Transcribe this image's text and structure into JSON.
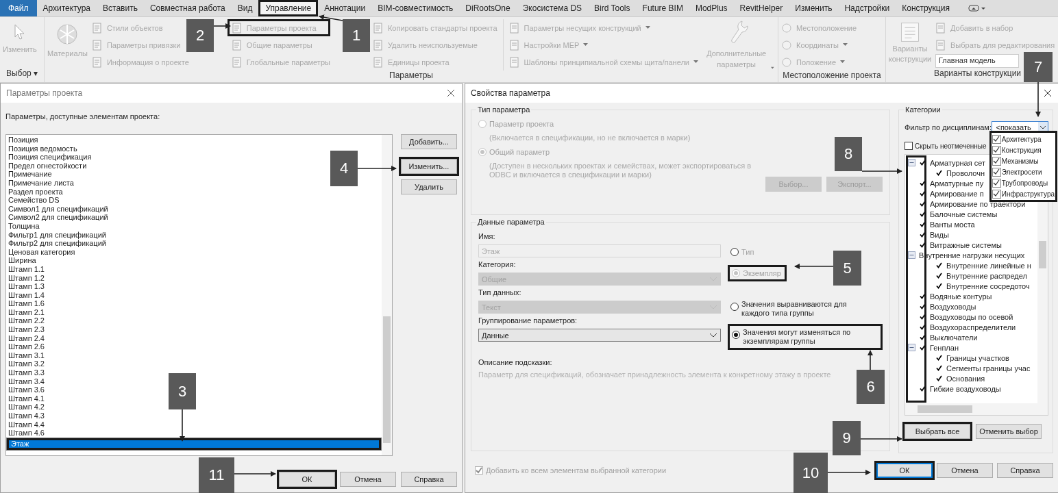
{
  "ribbon_tabs": [
    {
      "label": "Файл",
      "kind": "file",
      "selected": false
    },
    {
      "label": "Архитектура",
      "kind": "tab",
      "selected": false
    },
    {
      "label": "Вставить",
      "kind": "tab",
      "selected": false
    },
    {
      "label": "Совместная работа",
      "kind": "tab",
      "selected": false
    },
    {
      "label": "Вид",
      "kind": "tab",
      "selected": false
    },
    {
      "label": "Управление",
      "kind": "tab",
      "selected": true
    },
    {
      "label": "Аннотации",
      "kind": "tab",
      "selected": false
    },
    {
      "label": "BIM-совместимость",
      "kind": "tab",
      "selected": false
    },
    {
      "label": "DiRootsOne",
      "kind": "tab",
      "selected": false
    },
    {
      "label": "Экосистема DS",
      "kind": "tab",
      "selected": false
    },
    {
      "label": "Bird Tools",
      "kind": "tab",
      "selected": false
    },
    {
      "label": "Future BIM",
      "kind": "tab",
      "selected": false
    },
    {
      "label": "ModPlus",
      "kind": "tab",
      "selected": false
    },
    {
      "label": "RevitHelper",
      "kind": "tab",
      "selected": false
    },
    {
      "label": "Изменить",
      "kind": "tab",
      "selected": false
    },
    {
      "label": "Надстройки",
      "kind": "tab",
      "selected": false
    },
    {
      "label": "Конструкция",
      "kind": "tab",
      "selected": false
    }
  ],
  "ribbon": {
    "select_group": {
      "button": "Изменить",
      "label": "Выбор",
      "caret": "▾"
    },
    "params_group": {
      "label": "Параметры",
      "big_button": "Материалы",
      "columns": [
        [
          "Стили объектов",
          "Параметры привязки",
          "Информация о проекте"
        ],
        [
          "Параметры проекта",
          "Общие параметры",
          "Глобальные  параметры"
        ],
        [
          "Копировать стандарты проекта",
          "Удалить неиспользуемые",
          "Единицы проекта"
        ]
      ],
      "dropdowns": [
        "Параметры несущих конструкций",
        "Настройки MEP",
        "Шаблоны принципиальной схемы щита/панели"
      ],
      "extra_button": "Дополнительные параметры"
    },
    "location_group": {
      "label": "Местоположение проекта",
      "items": [
        {
          "label": "Местоположение",
          "dropdown": false
        },
        {
          "label": "Координаты",
          "dropdown": true
        },
        {
          "label": "Положение",
          "dropdown": true
        }
      ]
    },
    "options_group": {
      "label": "Варианты конструкции",
      "big_button": "Варианты конструкции",
      "items": [
        "Добавить в набор",
        "Выбрать для редактирования"
      ],
      "combo": "Главная модель"
    }
  },
  "project_dialog": {
    "title": "Параметры проекта",
    "caption": "Параметры, доступные элементам проекта:",
    "items": [
      {
        "label": "Позиция",
        "selected": false
      },
      {
        "label": "Позиция ведомость",
        "selected": false
      },
      {
        "label": "Позиция спецификация",
        "selected": false
      },
      {
        "label": "Предел огнестойкости",
        "selected": false
      },
      {
        "label": "Примечание",
        "selected": false
      },
      {
        "label": "Примечание листа",
        "selected": false
      },
      {
        "label": "Раздел проекта",
        "selected": false
      },
      {
        "label": "Семейство DS",
        "selected": false
      },
      {
        "label": "Символ1 для спецификаций",
        "selected": false
      },
      {
        "label": "Символ2 для спецификаций",
        "selected": false
      },
      {
        "label": "Толщина",
        "selected": false
      },
      {
        "label": "Фильтр1 для спецификаций",
        "selected": false
      },
      {
        "label": "Фильтр2 для спецификаций",
        "selected": false
      },
      {
        "label": "Ценовая категория",
        "selected": false
      },
      {
        "label": "Ширина",
        "selected": false
      },
      {
        "label": "Штамп 1.1",
        "selected": false
      },
      {
        "label": "Штамп 1.2",
        "selected": false
      },
      {
        "label": "Штамп 1.3",
        "selected": false
      },
      {
        "label": "Штамп 1.4",
        "selected": false
      },
      {
        "label": "Штамп 1.6",
        "selected": false
      },
      {
        "label": "Штамп 2.1",
        "selected": false
      },
      {
        "label": "Штамп 2.2",
        "selected": false
      },
      {
        "label": "Штамп 2.3",
        "selected": false
      },
      {
        "label": "Штамп 2.4",
        "selected": false
      },
      {
        "label": "Штамп 2.6",
        "selected": false
      },
      {
        "label": "Штамп 3.1",
        "selected": false
      },
      {
        "label": "Штамп 3.2",
        "selected": false
      },
      {
        "label": "Штамп 3.3",
        "selected": false
      },
      {
        "label": "Штамп 3.4",
        "selected": false
      },
      {
        "label": "Штамп 3.6",
        "selected": false
      },
      {
        "label": "Штамп 4.1",
        "selected": false
      },
      {
        "label": "Штамп 4.2",
        "selected": false
      },
      {
        "label": "Штамп 4.3",
        "selected": false
      },
      {
        "label": "Штамп 4.4",
        "selected": false
      },
      {
        "label": "Штамп 4.6",
        "selected": false
      },
      {
        "label": "Этаж",
        "selected": true
      }
    ],
    "side_buttons": [
      "Добавить...",
      "Изменить...",
      "Удалить"
    ],
    "buttons": [
      "ОК",
      "Отмена",
      "Справка"
    ]
  },
  "property_dialog": {
    "title": "Свойства параметра",
    "type_section": {
      "title": "Тип параметра",
      "options": [
        {
          "label": "Параметр проекта",
          "note": "(Включается в спецификации, но не включается в марки)",
          "selected": false,
          "disabled": true
        },
        {
          "label": "Общий параметр",
          "note": "(Доступен в нескольких проектах и семействах, может экспортироваться в ODBC и включается в спецификации и марки)",
          "selected": true,
          "disabled": true
        }
      ],
      "buttons": [
        {
          "label": "Выбор...",
          "disabled": true
        },
        {
          "label": "Экспорт...",
          "disabled": true
        }
      ]
    },
    "data_section": {
      "title": "Данные параметра",
      "fields": [
        {
          "label": "Имя:",
          "kind": "input",
          "value": "Этаж",
          "disabled": true
        },
        {
          "label": "Категория:",
          "kind": "select",
          "value": "Общие",
          "disabled": true
        },
        {
          "label": "Тип данных:",
          "kind": "select",
          "value": "Текст",
          "disabled": true
        },
        {
          "label": "Группирование параметров:",
          "kind": "select",
          "value": "Данные",
          "disabled": false
        }
      ],
      "instance_options": [
        {
          "label": "Тип",
          "selected": false,
          "disabled": false
        },
        {
          "label": "Экземпляр",
          "selected": true,
          "disabled": true
        }
      ],
      "group_options": [
        {
          "label": "Значения выравниваются для каждого типа группы",
          "selected": false
        },
        {
          "label": "Значения могут изменяться по экземплярам группы",
          "selected": true
        }
      ],
      "tooltip_label": "Описание подсказки:",
      "tooltip_text": "Параметр для спецификаций, обозначает принадлежность элемента к конкретному этажу в проекте"
    },
    "add_to_all": {
      "label": "Добавить ко всем элементам выбранной категории",
      "checked": true,
      "disabled": true
    },
    "categories": {
      "title": "Категории",
      "filter_label": "Фильтр по дисциплинам:",
      "filter_value": "<показать",
      "disciplines": [
        {
          "label": "Архитектура",
          "checked": true
        },
        {
          "label": "Конструкция",
          "checked": true
        },
        {
          "label": "Механизмы",
          "checked": true
        },
        {
          "label": "Электросети",
          "checked": true
        },
        {
          "label": "Трубопроводы",
          "checked": true
        },
        {
          "label": "Инфраструктура",
          "checked": true
        }
      ],
      "hide_unchecked": {
        "label": "Скрыть неотмеченные",
        "checked": false
      },
      "tree": [
        {
          "label": "Арматурная сет",
          "kind": "checkbox",
          "checked": true,
          "expanded": true,
          "children": [
            {
              "label": "Проволочн",
              "kind": "checkbox",
              "checked": true
            }
          ]
        },
        {
          "label": "Арматурные пу",
          "kind": "checkbox",
          "checked": true
        },
        {
          "label": "Армирование п",
          "kind": "checkbox",
          "checked": true
        },
        {
          "label": "Армирование по траектори",
          "kind": "checkbox",
          "checked": true
        },
        {
          "label": "Балочные системы",
          "kind": "checkbox",
          "checked": true
        },
        {
          "label": "Ванты моста",
          "kind": "checkbox",
          "checked": true
        },
        {
          "label": "Виды",
          "kind": "checkbox",
          "checked": true
        },
        {
          "label": "Витражные системы",
          "kind": "checkbox",
          "checked": true
        },
        {
          "label": "Внутренние нагрузки несущих",
          "kind": "plain",
          "expanded": true,
          "children": [
            {
              "label": "Внутренние линейные н",
              "kind": "checkbox",
              "checked": true
            },
            {
              "label": "Внутренние распредел",
              "kind": "checkbox",
              "checked": true
            },
            {
              "label": "Внутренние сосредоточ",
              "kind": "checkbox",
              "checked": true
            }
          ]
        },
        {
          "label": "Водяные контуры",
          "kind": "checkbox",
          "checked": true
        },
        {
          "label": "Воздуховоды",
          "kind": "checkbox",
          "checked": true
        },
        {
          "label": "Воздуховоды по осевой",
          "kind": "checkbox",
          "checked": true
        },
        {
          "label": "Воздухораспределители",
          "kind": "checkbox",
          "checked": true
        },
        {
          "label": "Выключатели",
          "kind": "checkbox",
          "checked": true
        },
        {
          "label": "Генплан",
          "kind": "checkbox",
          "checked": true,
          "expanded": true,
          "children": [
            {
              "label": "Границы участков",
              "kind": "checkbox",
              "checked": true
            },
            {
              "label": "Сегменты границы учас",
              "kind": "checkbox",
              "checked": true
            },
            {
              "label": "Основания",
              "kind": "checkbox",
              "checked": true
            }
          ]
        },
        {
          "label": "Гибкие воздуховоды",
          "kind": "checkbox",
          "checked": true
        }
      ],
      "buttons": [
        "Выбрать все",
        "Отменить выбор"
      ]
    },
    "buttons": [
      "ОК",
      "Отмена",
      "Справка"
    ]
  },
  "callouts": [
    {
      "number": "1"
    },
    {
      "number": "2"
    },
    {
      "number": "3"
    },
    {
      "number": "4"
    },
    {
      "number": "5"
    },
    {
      "number": "6"
    },
    {
      "number": "7"
    },
    {
      "number": "8"
    },
    {
      "number": "9"
    },
    {
      "number": "10"
    },
    {
      "number": "11"
    }
  ]
}
